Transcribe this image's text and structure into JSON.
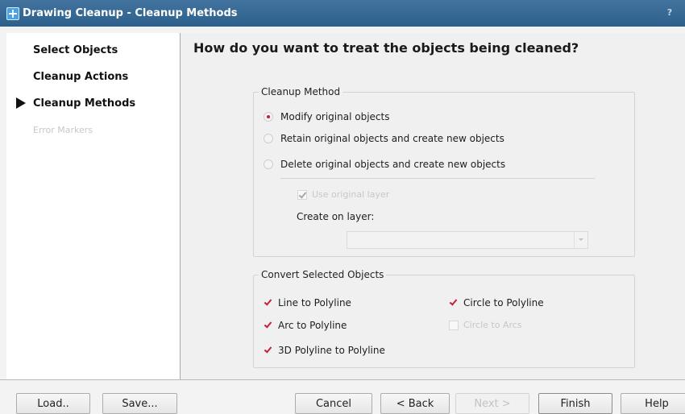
{
  "window": {
    "title": "Drawing Cleanup - Cleanup Methods",
    "help_glyph": "?"
  },
  "sidebar": {
    "items": [
      {
        "label": "Select Objects",
        "state": "normal"
      },
      {
        "label": "Cleanup Actions",
        "state": "normal"
      },
      {
        "label": "Cleanup Methods",
        "state": "current"
      },
      {
        "label": "Error Markers",
        "state": "disabled"
      }
    ]
  },
  "main": {
    "heading": "How do you want to treat the objects being cleaned?",
    "cleanup_method": {
      "legend": "Cleanup Method",
      "options": [
        {
          "label": "Modify original objects",
          "selected": true
        },
        {
          "label": "Retain original objects and create new objects",
          "selected": false
        },
        {
          "label": "Delete original objects and create new objects",
          "selected": false
        }
      ],
      "use_original_layer": {
        "label": "Use original layer",
        "checked": true,
        "enabled": false
      },
      "create_on_layer": {
        "label": "Create on layer:",
        "value": ""
      }
    },
    "convert_selected_objects": {
      "legend": "Convert Selected Objects",
      "options": [
        {
          "label": "Line to Polyline",
          "checked": true,
          "enabled": true
        },
        {
          "label": "Circle to Polyline",
          "checked": true,
          "enabled": true
        },
        {
          "label": "Arc to Polyline",
          "checked": true,
          "enabled": true
        },
        {
          "label": "Circle to Arcs",
          "checked": false,
          "enabled": false
        },
        {
          "label": "3D Polyline to Polyline",
          "checked": true,
          "enabled": true
        }
      ]
    }
  },
  "footer": {
    "load": "Load..",
    "save": "Save...",
    "cancel": "Cancel",
    "back": "< Back",
    "next": "Next >",
    "finish": "Finish",
    "help": "Help"
  },
  "colors": {
    "titlebar": "#2d5f8c",
    "accent_mark": "#c41f3e"
  }
}
